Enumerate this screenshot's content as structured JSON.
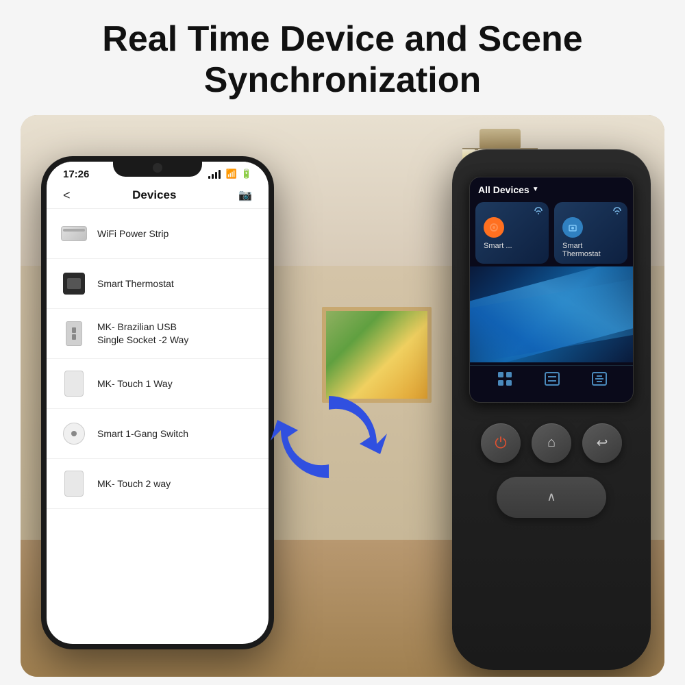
{
  "header": {
    "title_line1": "Real Time Device and Scene",
    "title_line2": "Synchronization"
  },
  "phone": {
    "status_time": "17:26",
    "nav_title": "Devices",
    "devices": [
      {
        "id": "wifi-power-strip",
        "label": "WiFi Power Strip",
        "icon_type": "wifi-strip"
      },
      {
        "id": "smart-thermostat",
        "label": "Smart Thermostat",
        "icon_type": "thermostat"
      },
      {
        "id": "mk-socket",
        "label": "MK- Brazilian USB\nSingle Socket -2 Way",
        "icon_type": "socket"
      },
      {
        "id": "mk-touch-1",
        "label": "MK- Touch 1 Way",
        "icon_type": "touch"
      },
      {
        "id": "smart-switch",
        "label": "Smart 1-Gang Switch",
        "icon_type": "switch"
      },
      {
        "id": "mk-touch-2",
        "label": "MK- Touch 2 way",
        "icon_type": "touch"
      }
    ]
  },
  "remote": {
    "header_label": "All Devices",
    "cards": [
      {
        "id": "card-left",
        "label": "Smart ...",
        "icon_color": "orange"
      },
      {
        "id": "card-right",
        "label": "Smart\nThermostat",
        "icon_color": "blue"
      }
    ]
  },
  "sync_icon": "⟳"
}
